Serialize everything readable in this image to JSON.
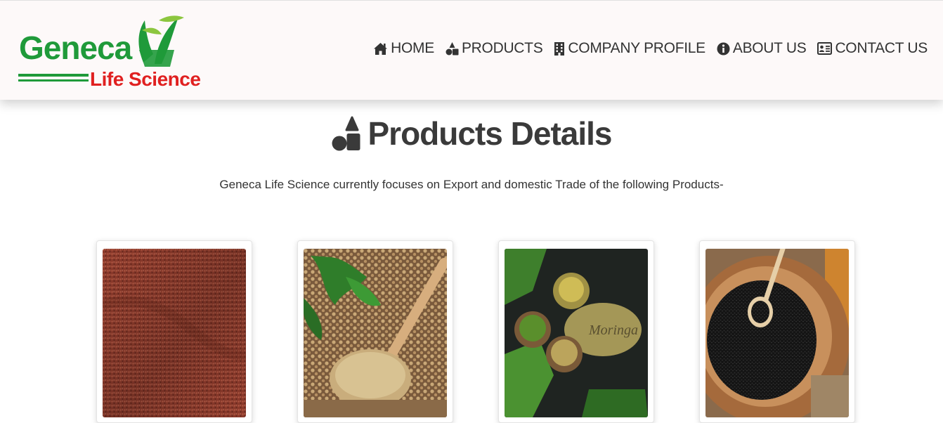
{
  "brand": {
    "name_top": "Geneca",
    "name_bottom": "Life Science",
    "colors": {
      "green": "#1f9a3a",
      "red": "#e02020"
    }
  },
  "nav": {
    "items": [
      {
        "label": "HOME",
        "icon": "home-icon"
      },
      {
        "label": "PRODUCTS",
        "icon": "shapes-icon"
      },
      {
        "label": "COMPANY PROFILE",
        "icon": "building-icon"
      },
      {
        "label": "ABOUT US",
        "icon": "info-circle-icon"
      },
      {
        "label": "CONTACT US",
        "icon": "address-card-icon"
      }
    ]
  },
  "main": {
    "title": "Products Details",
    "title_icon": "shapes-icon",
    "intro": "Geneca Life Science currently focuses on Export and domestic Trade of the following Products-",
    "products": [
      {
        "image": "red-seeds-image"
      },
      {
        "image": "coriander-powder-image"
      },
      {
        "image": "moringa-powder-image"
      },
      {
        "image": "black-seeds-image"
      }
    ]
  }
}
